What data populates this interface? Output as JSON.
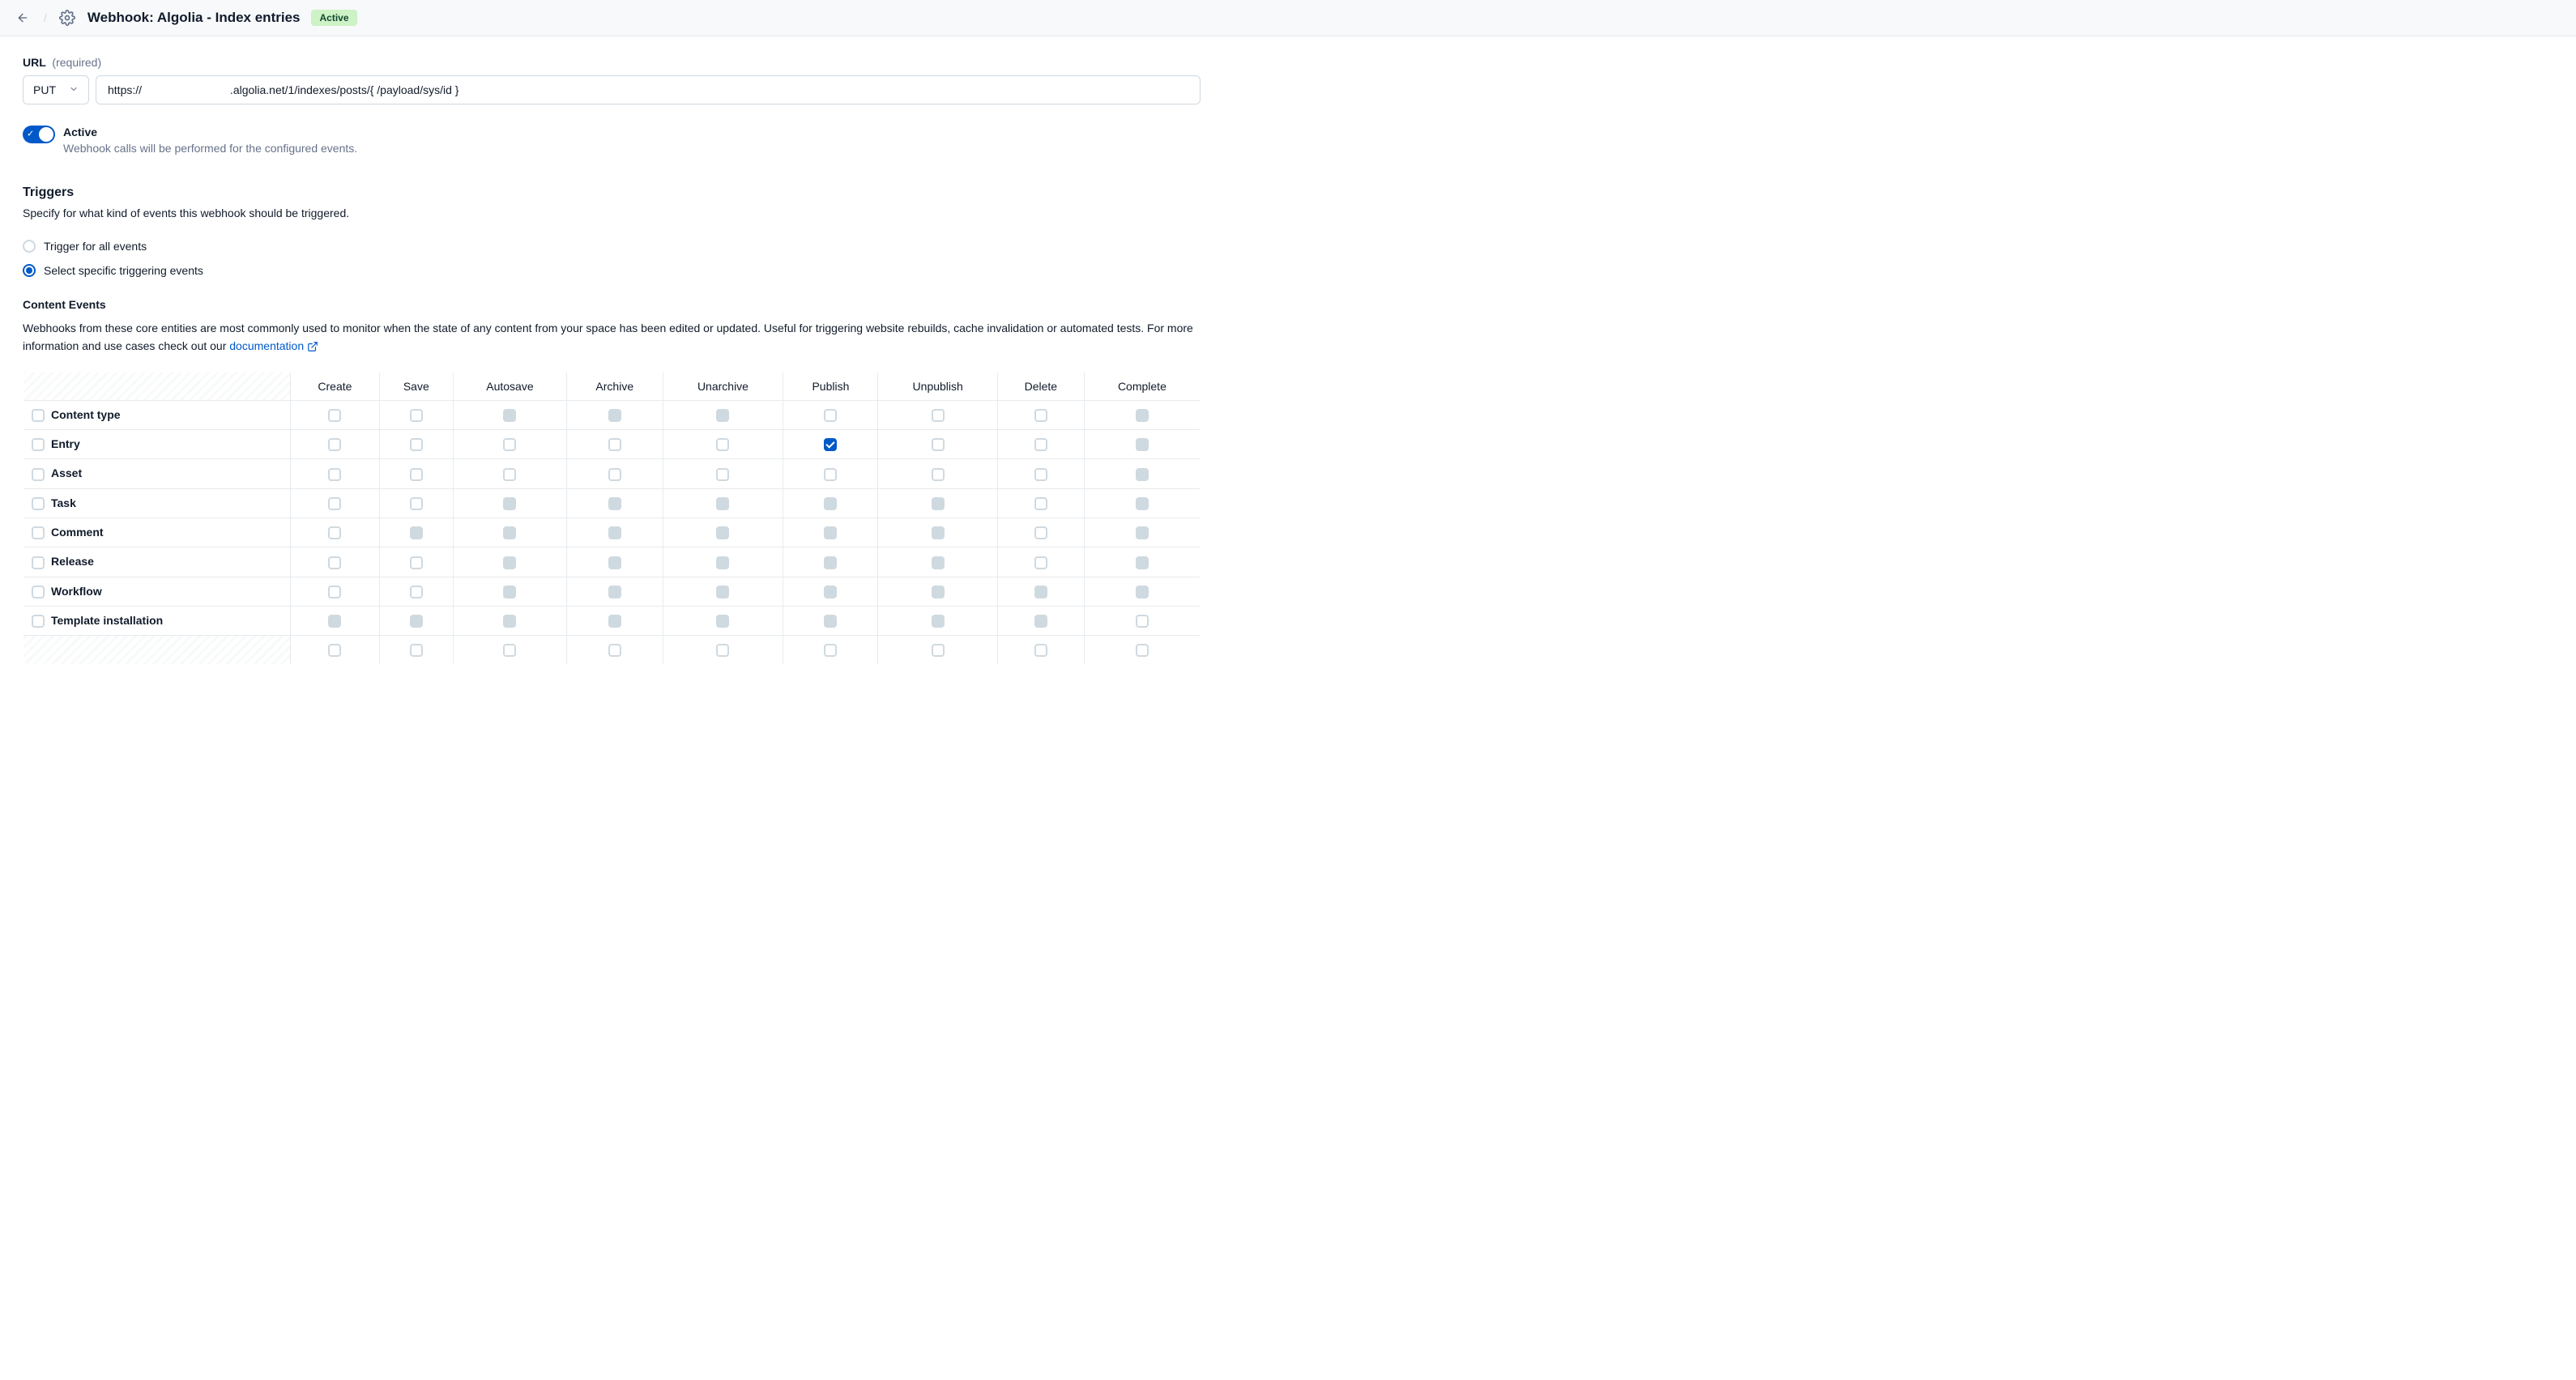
{
  "header": {
    "title": "Webhook: Algolia - Index entries",
    "status_badge": "Active"
  },
  "url_section": {
    "label": "URL",
    "required": "(required)",
    "method": "PUT",
    "url_value": "https://                            .algolia.net/1/indexes/posts/{ /payload/sys/id }"
  },
  "active_toggle": {
    "enabled": true,
    "label": "Active",
    "help": "Webhook calls will be performed for the configured events."
  },
  "triggers": {
    "title": "Triggers",
    "desc": "Specify for what kind of events this webhook should be triggered.",
    "option_all": "Trigger for all events",
    "option_specific": "Select specific triggering events",
    "selected": "specific"
  },
  "content_events": {
    "title": "Content Events",
    "desc_pre": "Webhooks from these core entities are most commonly used to monitor when the state of any content from your space has been edited or updated. Useful for triggering website rebuilds, cache invalidation or automated tests. For more information and use cases check out our ",
    "doc_link": "documentation",
    "columns": [
      "Create",
      "Save",
      "Autosave",
      "Archive",
      "Unarchive",
      "Publish",
      "Unpublish",
      "Delete",
      "Complete"
    ],
    "rows": [
      {
        "label": "Content type",
        "cells": [
          "e",
          "e",
          "d",
          "d",
          "d",
          "e",
          "e",
          "e",
          "d"
        ]
      },
      {
        "label": "Entry",
        "cells": [
          "e",
          "e",
          "e",
          "e",
          "e",
          "c",
          "e",
          "e",
          "d"
        ]
      },
      {
        "label": "Asset",
        "cells": [
          "e",
          "e",
          "e",
          "e",
          "e",
          "e",
          "e",
          "e",
          "d"
        ]
      },
      {
        "label": "Task",
        "cells": [
          "e",
          "e",
          "d",
          "d",
          "d",
          "d",
          "d",
          "e",
          "d"
        ]
      },
      {
        "label": "Comment",
        "cells": [
          "e",
          "d",
          "d",
          "d",
          "d",
          "d",
          "d",
          "e",
          "d"
        ]
      },
      {
        "label": "Release",
        "cells": [
          "e",
          "e",
          "d",
          "d",
          "d",
          "d",
          "d",
          "e",
          "d"
        ]
      },
      {
        "label": "Workflow",
        "cells": [
          "e",
          "e",
          "d",
          "d",
          "d",
          "d",
          "d",
          "d",
          "d"
        ]
      },
      {
        "label": "Template installation",
        "cells": [
          "d",
          "d",
          "d",
          "d",
          "d",
          "d",
          "d",
          "d",
          "e"
        ]
      },
      {
        "label": "",
        "cells": [
          "e",
          "e",
          "e",
          "e",
          "e",
          "e",
          "e",
          "e",
          "e"
        ],
        "striped": true
      }
    ]
  }
}
